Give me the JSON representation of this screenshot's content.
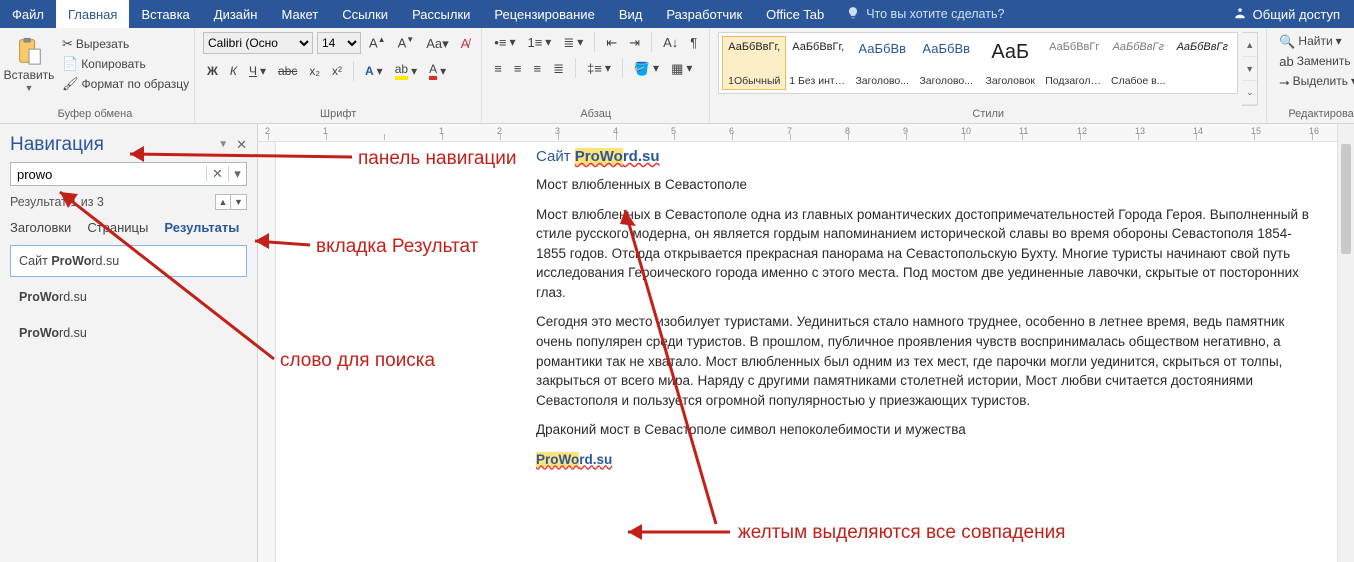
{
  "tabs": {
    "file": "Файл",
    "home": "Главная",
    "insert": "Вставка",
    "design": "Дизайн",
    "layout": "Макет",
    "references": "Ссылки",
    "mailings": "Рассылки",
    "review": "Рецензирование",
    "view": "Вид",
    "developer": "Разработчик",
    "officetab": "Office Tab",
    "tell_me": "Что вы хотите сделать?",
    "share": "Общий доступ"
  },
  "ribbon": {
    "paste": "Вставить",
    "cut": "Вырезать",
    "copy": "Копировать",
    "format_painter": "Формат по образцу",
    "clipboard_group": "Буфер обмена",
    "font_name": "Calibri (Осно",
    "font_size": "14",
    "font_group": "Шрифт",
    "para_group": "Абзац",
    "styles_group": "Стили",
    "editing_group": "Редактирование",
    "find": "Найти",
    "replace": "Заменить",
    "select": "Выделить",
    "styles": [
      {
        "sample": "АаБбВвГг,",
        "name": "1Обычный",
        "selected": true,
        "cls": ""
      },
      {
        "sample": "АаБбВвГг,",
        "name": "1 Без инте...",
        "cls": ""
      },
      {
        "sample": "АаБбВв",
        "name": "Заголово...",
        "cls": "blue"
      },
      {
        "sample": "АаБбВв",
        "name": "Заголово...",
        "cls": "blue"
      },
      {
        "sample": "АаБ",
        "name": "Заголовок",
        "cls": "big"
      },
      {
        "sample": "АаБбВвГг",
        "name": "Подзаголо...",
        "cls": "gray"
      },
      {
        "sample": "АаБбВвГг",
        "name": "Слабое в...",
        "cls": "gray-it"
      },
      {
        "sample": "АаБбВвГг",
        "name": "",
        "cls": "ital"
      }
    ]
  },
  "nav": {
    "title": "Навигация",
    "search_value": "prowo",
    "result_status": "Результат 1 из 3",
    "tab_headings": "Заголовки",
    "tab_pages": "Страницы",
    "tab_results": "Результаты",
    "items": [
      {
        "pre": "Сайт ",
        "hl": "ProWo",
        "post": "rd.su",
        "active": true
      },
      {
        "pre": "",
        "hl": "ProWo",
        "post": "rd.su",
        "active": false
      },
      {
        "pre": "",
        "hl": "ProWo",
        "post": "rd.su",
        "active": false
      }
    ]
  },
  "doc": {
    "heading_pre": "Сайт ",
    "heading_hl": "ProWo",
    "heading_post": "rd.su",
    "p1": "Мост влюбленных в Севастополе",
    "p2": "Мост влюбленных в Севастополе одна из главных романтических достопримечательностей Города Героя. Выполненный в стиле русского модерна, он является гордым напоминанием исторической славы во время обороны Севастополя 1854-1855 годов. Отсюда открывается прекрасная панорама на Севастопольскую Бухту. Многие туристы начинают свой путь исследования Героического города именно с этого места. Под мостом две уединенные лавочки, скрытые от посторонних глаз.",
    "p3": "Сегодня это место изобилует туристами. Уединиться стало намного труднее, особенно в летнее время, ведь памятник очень популярен среди туристов. В прошлом, публичное проявления чувств воспринималась обществом негативно, а романтики так не хватало. Мост влюбленных был одним из тех мест, где парочки могли уединится, скрыться от толпы, закрыться от всего мира. Наряду с другими памятниками столетней истории, Мост любви считается достояниями Севастополя и пользуется огромной популярностью у приезжающих туристов.",
    "p4": "Драконий мост в Севастополе символ непоколебимости и мужества",
    "match_hl": "ProWo",
    "match_post": "rd.su"
  },
  "annotations": {
    "nav_panel": "панель навигации",
    "tab_result": "вкладка Результат",
    "search_word": "слово для поиска",
    "highlight": "желтым выделяются все совпадения"
  },
  "ruler_ticks": [
    "2",
    "1",
    "",
    "1",
    "2",
    "3",
    "4",
    "5",
    "6",
    "7",
    "8",
    "9",
    "10",
    "11",
    "12",
    "13",
    "14",
    "15",
    "16",
    "",
    "",
    "",
    ""
  ]
}
